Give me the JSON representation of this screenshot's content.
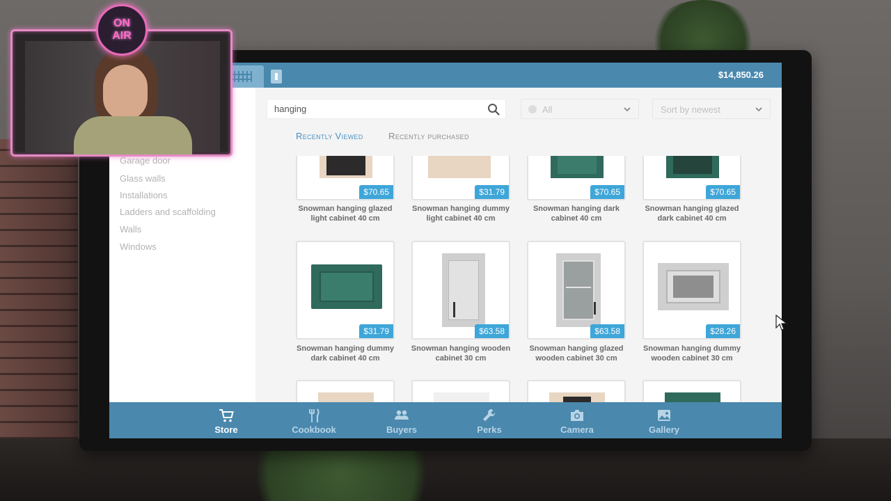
{
  "header": {
    "balance": "$14,850.26"
  },
  "search": {
    "value": "hanging",
    "placeholder": ""
  },
  "filters": {
    "category_label": "All",
    "sort_label": "Sort by newest"
  },
  "tabs": [
    {
      "label": "Recently Viewed",
      "active": true
    },
    {
      "label": "Recently purchased",
      "active": false
    }
  ],
  "sidebar": {
    "items": [
      {
        "label": "Garage door"
      },
      {
        "label": "Glass walls"
      },
      {
        "label": "Installations"
      },
      {
        "label": "Ladders and scaffolding"
      },
      {
        "label": "Walls"
      },
      {
        "label": "Windows"
      }
    ]
  },
  "products": [
    {
      "name": "Snowman hanging glazed light cabinet 40 cm",
      "price": "$70.65",
      "color": "#e8d6c2"
    },
    {
      "name": "Snowman hanging dummy light cabinet 40 cm",
      "price": "$31.79",
      "color": "#e8d6c2"
    },
    {
      "name": "Snowman hanging dark cabinet 40 cm",
      "price": "$70.65",
      "color": "#2f6a5c"
    },
    {
      "name": "Snowman hanging glazed dark cabinet 40 cm",
      "price": "$70.65",
      "color": "#2f6a5c"
    },
    {
      "name": "Snowman hanging dummy dark cabinet 40 cm",
      "price": "$31.79",
      "color": "#2f6a5c"
    },
    {
      "name": "Snowman hanging wooden cabinet 30 cm",
      "price": "$63.58",
      "color": "#cfcfcf"
    },
    {
      "name": "Snowman hanging glazed wooden cabinet 30 cm",
      "price": "$63.58",
      "color": "#cfcfcf"
    },
    {
      "name": "Snowman hanging dummy wooden cabinet 30 cm",
      "price": "$28.26",
      "color": "#cfcfcf"
    },
    {
      "name": "",
      "price": "",
      "color": "#e8d6c2"
    },
    {
      "name": "",
      "price": "",
      "color": "#f0f0f0"
    },
    {
      "name": "",
      "price": "",
      "color": "#e8d6c2"
    },
    {
      "name": "",
      "price": "",
      "color": "#2f6a5c"
    }
  ],
  "nav": {
    "items": [
      {
        "label": "Store",
        "icon": "cart-icon",
        "active": true
      },
      {
        "label": "Cookbook",
        "icon": "cutlery-icon",
        "active": false
      },
      {
        "label": "Buyers",
        "icon": "people-icon",
        "active": false
      },
      {
        "label": "Perks",
        "icon": "wrench-icon",
        "active": false
      },
      {
        "label": "Camera",
        "icon": "camera-icon",
        "active": false
      },
      {
        "label": "Gallery",
        "icon": "image-icon",
        "active": false
      }
    ]
  },
  "overlay": {
    "badge_line1": "ON",
    "badge_line2": "AIR",
    "accent_color": "#e86ab8"
  },
  "colors": {
    "bar_blue": "#4a88ad",
    "price_blue": "#3ea6d8",
    "tab_active": "#4a90c0"
  }
}
